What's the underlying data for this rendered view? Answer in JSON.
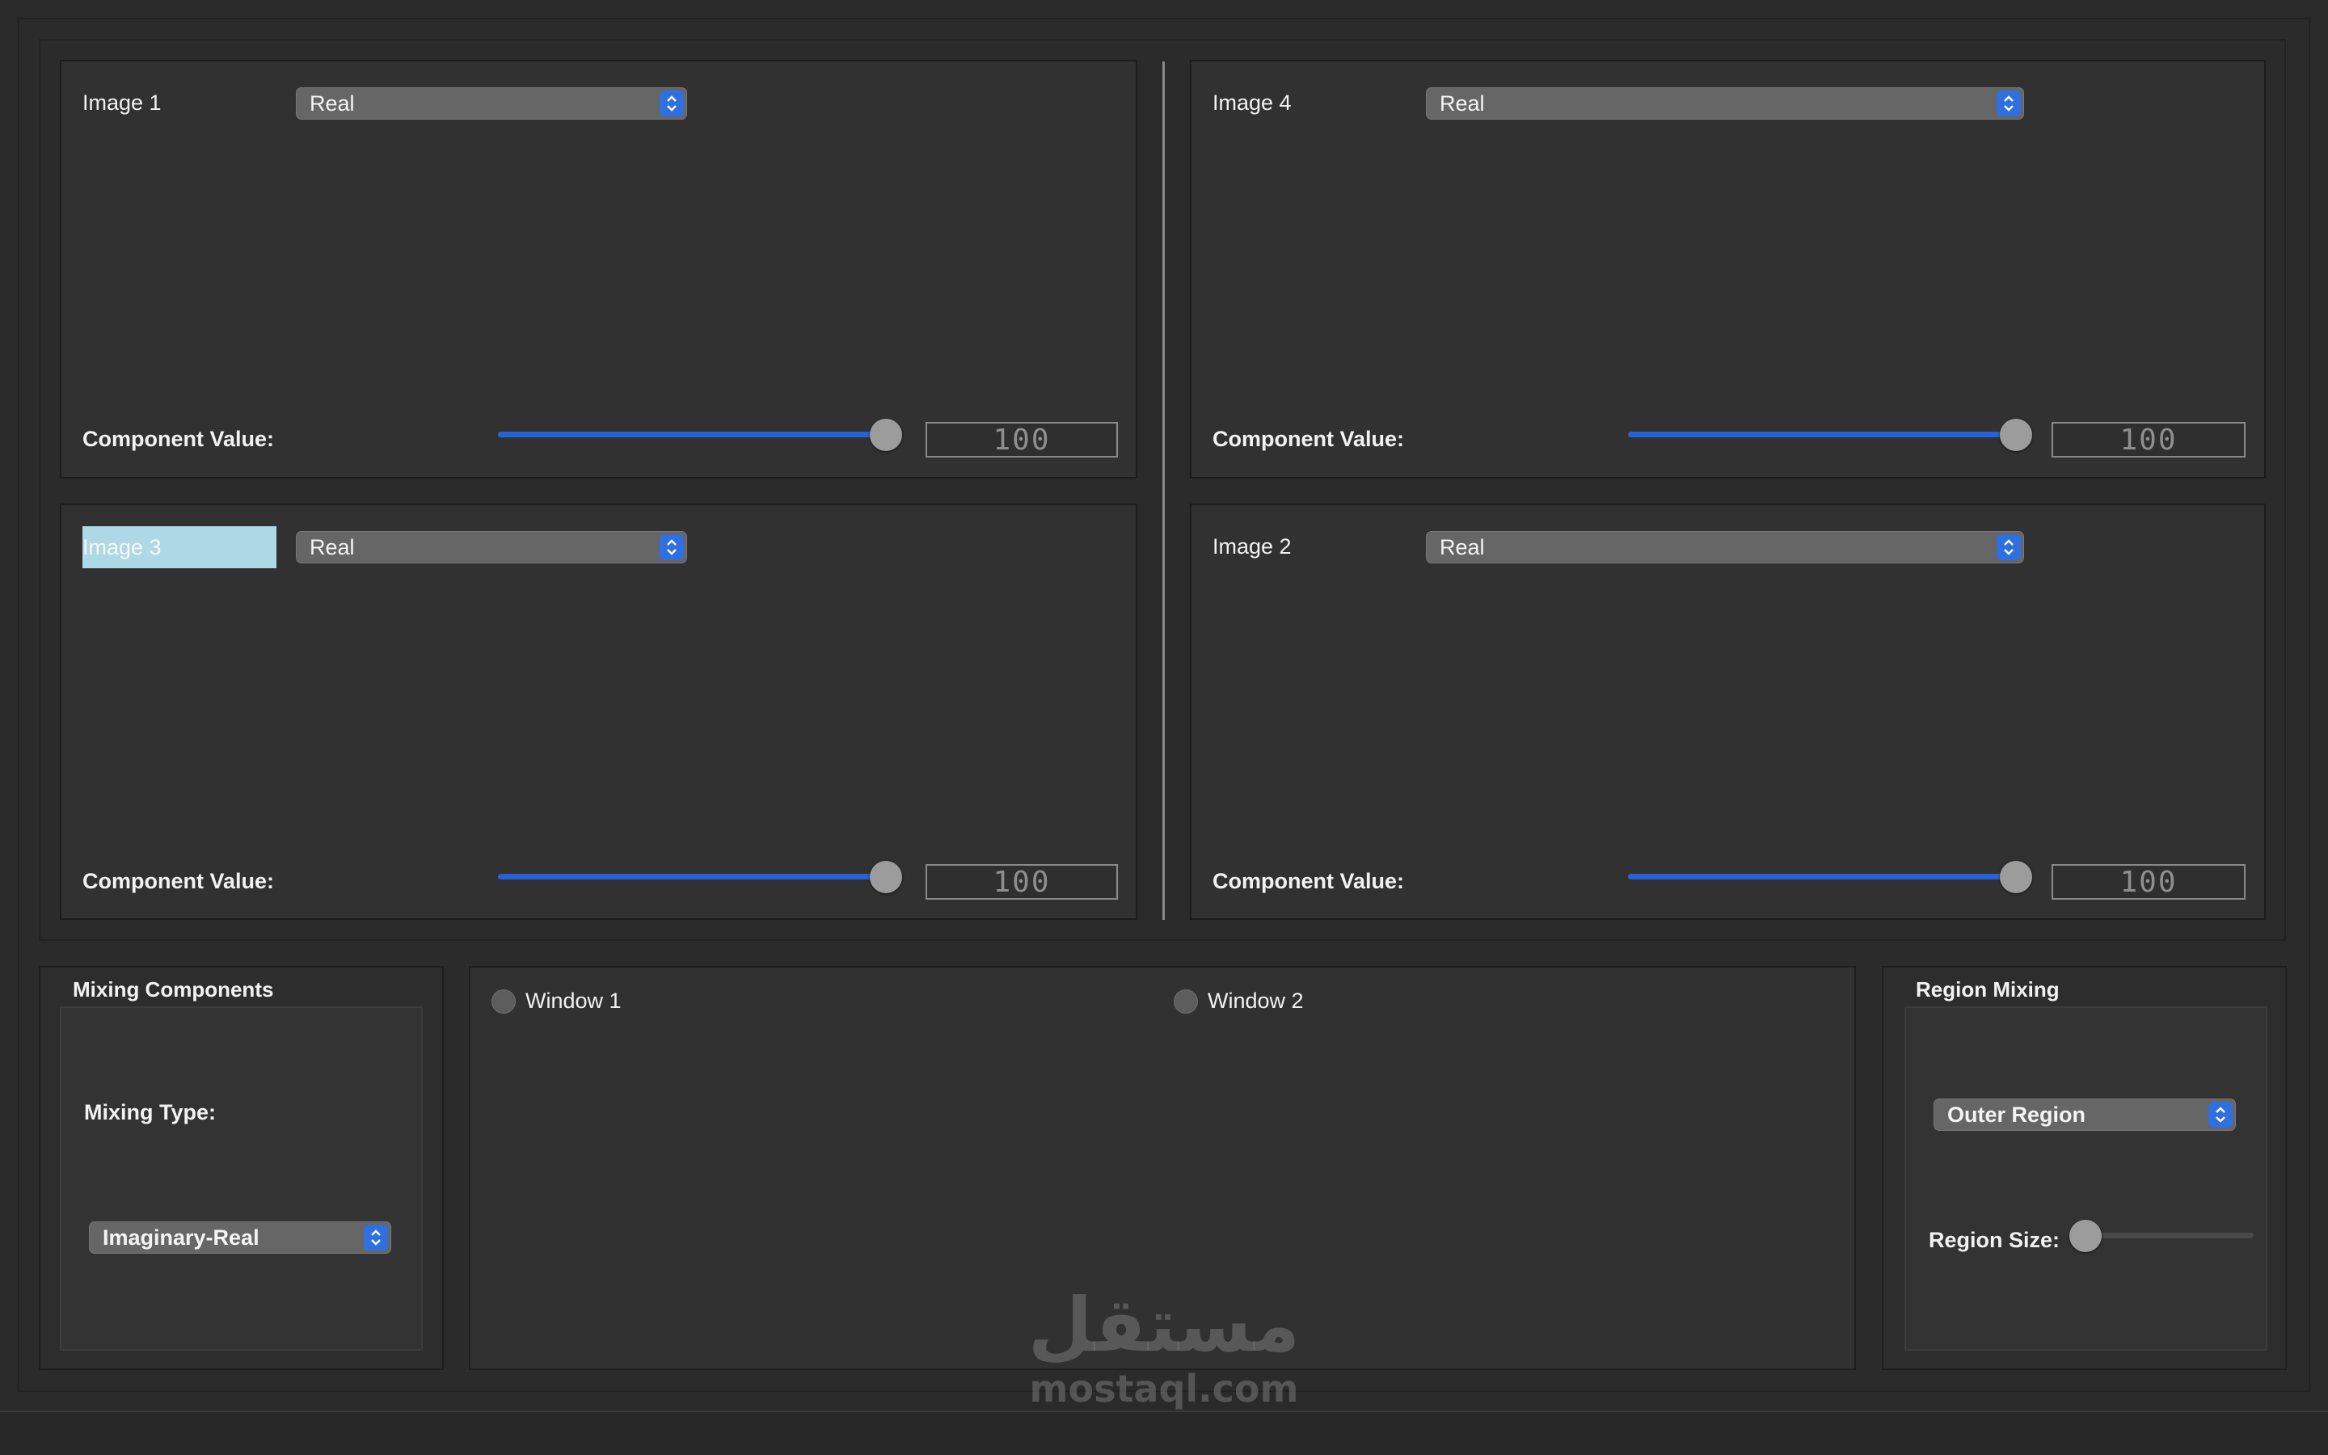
{
  "viewers": [
    {
      "title": "Image 1",
      "select_value": "Real",
      "component_label": "Component Value:",
      "component_value": 100,
      "slider_fraction": 0.98
    },
    {
      "title": "Image 4",
      "select_value": "Real",
      "component_label": "Component Value:",
      "component_value": 100,
      "slider_fraction": 0.98
    },
    {
      "title": "Image 3",
      "select_value": "Real",
      "component_label": "Component Value:",
      "component_value": 100,
      "slider_fraction": 0.98
    },
    {
      "title": "Image 2",
      "select_value": "Real",
      "component_label": "Component Value:",
      "component_value": 100,
      "slider_fraction": 0.98
    }
  ],
  "mixing_components": {
    "title": "Mixing Components",
    "type_label": "Mixing Type:",
    "type_value": "Imaginary-Real"
  },
  "output": {
    "window1_label": "Window 1",
    "window2_label": "Window 2"
  },
  "region_mixing": {
    "title": "Region Mixing",
    "region_value": "Outer Region",
    "size_label": "Region Size:",
    "size_fraction": 0.0
  },
  "watermark": {
    "text": "mostaql.com",
    "logo_text": "مستقل"
  },
  "colors": {
    "accent": "#2f6fe0",
    "slider_fill": "#2563d6",
    "selected_label_bg": "#add8e6"
  },
  "icons": {
    "select_arrow": "chevron-up-down-icon",
    "radio": "radio-button-icon"
  }
}
